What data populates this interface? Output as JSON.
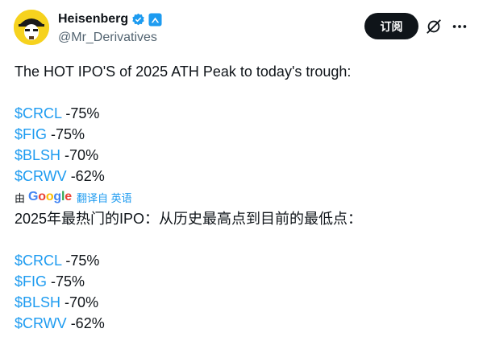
{
  "header": {
    "display_name": "Heisenberg",
    "handle": "@Mr_Derivatives",
    "subscribe_label": "订阅"
  },
  "tweet": {
    "line1": "The HOT IPO'S of 2025 ATH Peak to today's trough:",
    "items": [
      {
        "ticker": "$CRCL",
        "change": " -75%"
      },
      {
        "ticker": "$FIG",
        "change": " -75%"
      },
      {
        "ticker": "$BLSH",
        "change": " -70%"
      },
      {
        "ticker": "$CRWV",
        "change": " -62%"
      }
    ]
  },
  "translation": {
    "prefix": "由",
    "provider": "Google",
    "link_label": "翻译自 英语",
    "line1": "2025年最热门的IPO：从历史最高点到目前的最低点：",
    "items": [
      {
        "ticker": "$CRCL",
        "change": " -75%"
      },
      {
        "ticker": "$FIG",
        "change": " -75%"
      },
      {
        "ticker": "$BLSH",
        "change": " -70%"
      },
      {
        "ticker": "$CRWV",
        "change": " -62%"
      }
    ]
  },
  "colors": {
    "link": "#1d9bf0",
    "verified": "#1d9bf0",
    "avatar_bg": "#f6d21e"
  },
  "icons": [
    "avatar-icon",
    "verified-badge-icon",
    "affiliate-badge-icon",
    "grok-icon",
    "more-icon"
  ]
}
